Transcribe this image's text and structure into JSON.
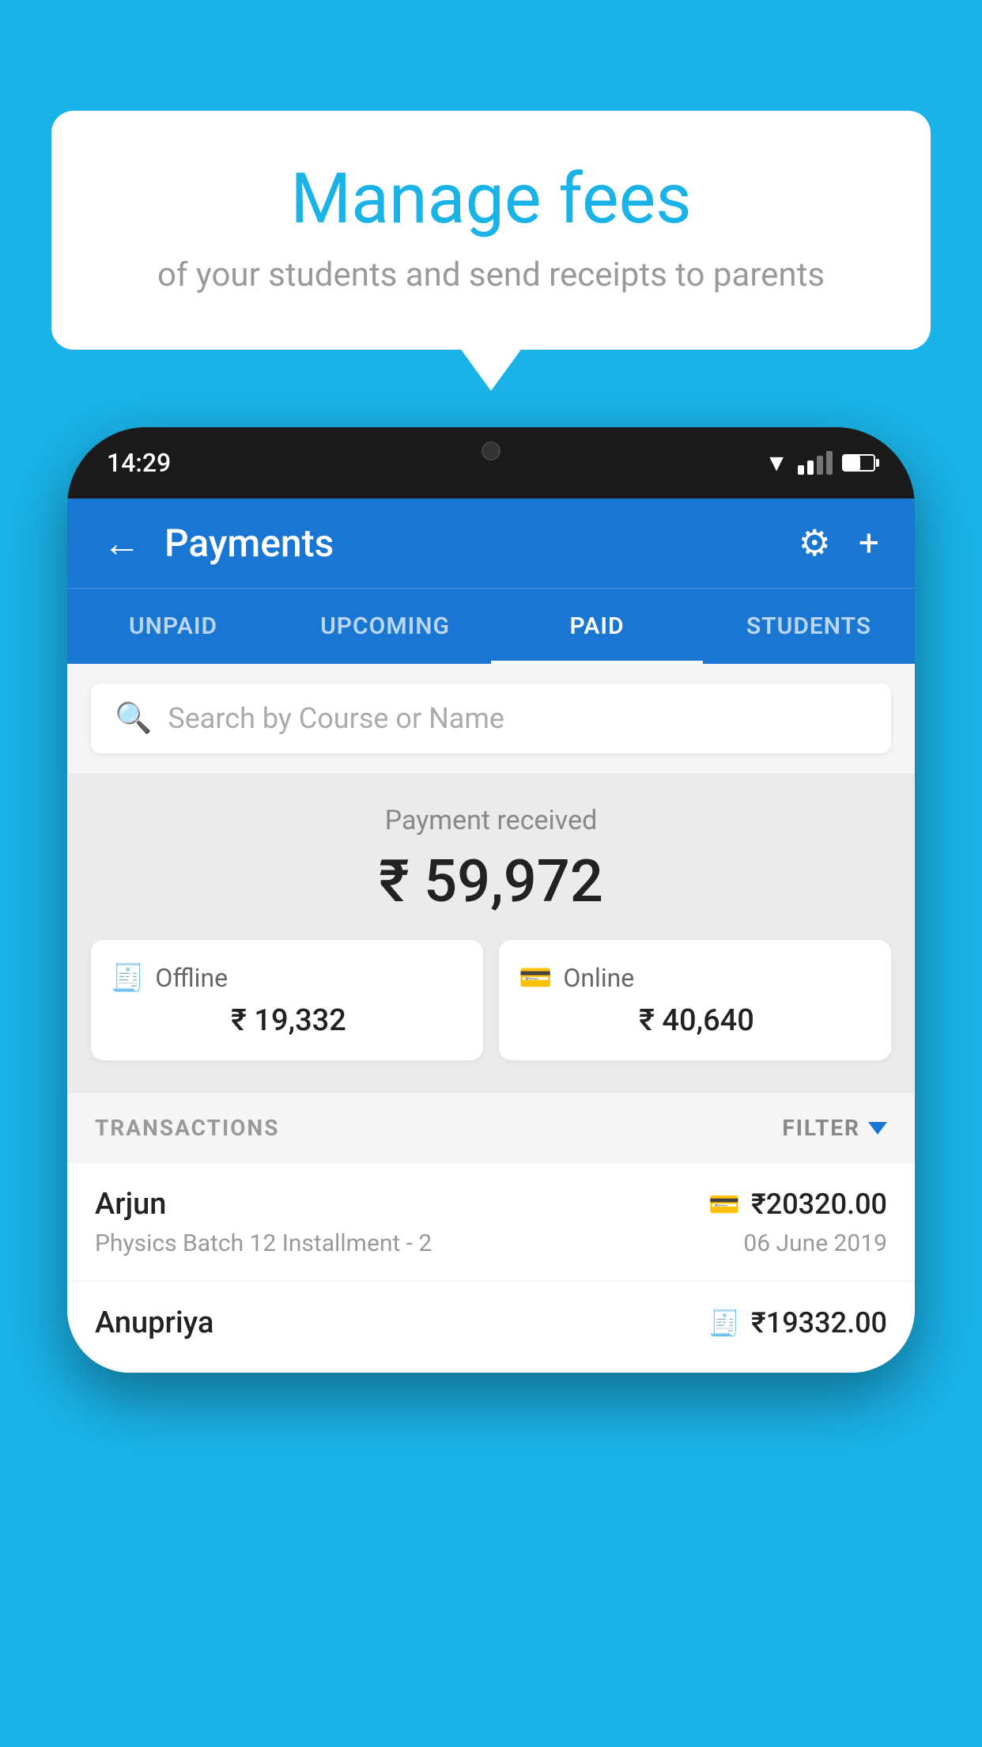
{
  "background_color": "#1ab3e8",
  "speech_bubble": {
    "title": "Manage fees",
    "subtitle": "of your students and send receipts to parents"
  },
  "phone": {
    "status_bar": {
      "time": "14:29"
    },
    "header": {
      "title": "Payments",
      "back_label": "←",
      "gear_label": "⚙",
      "plus_label": "+"
    },
    "tabs": [
      {
        "label": "UNPAID",
        "active": false
      },
      {
        "label": "UPCOMING",
        "active": false
      },
      {
        "label": "PAID",
        "active": true
      },
      {
        "label": "STUDENTS",
        "active": false
      }
    ],
    "search": {
      "placeholder": "Search by Course or Name"
    },
    "payment_received": {
      "label": "Payment received",
      "amount": "₹ 59,972",
      "offline": {
        "type": "Offline",
        "amount": "₹ 19,332"
      },
      "online": {
        "type": "Online",
        "amount": "₹ 40,640"
      }
    },
    "transactions": {
      "section_label": "TRANSACTIONS",
      "filter_label": "FILTER",
      "items": [
        {
          "name": "Arjun",
          "course": "Physics Batch 12 Installment - 2",
          "amount": "₹20320.00",
          "date": "06 June 2019",
          "payment_type": "online"
        },
        {
          "name": "Anupriya",
          "course": "",
          "amount": "₹19332.00",
          "date": "",
          "payment_type": "offline"
        }
      ]
    }
  }
}
